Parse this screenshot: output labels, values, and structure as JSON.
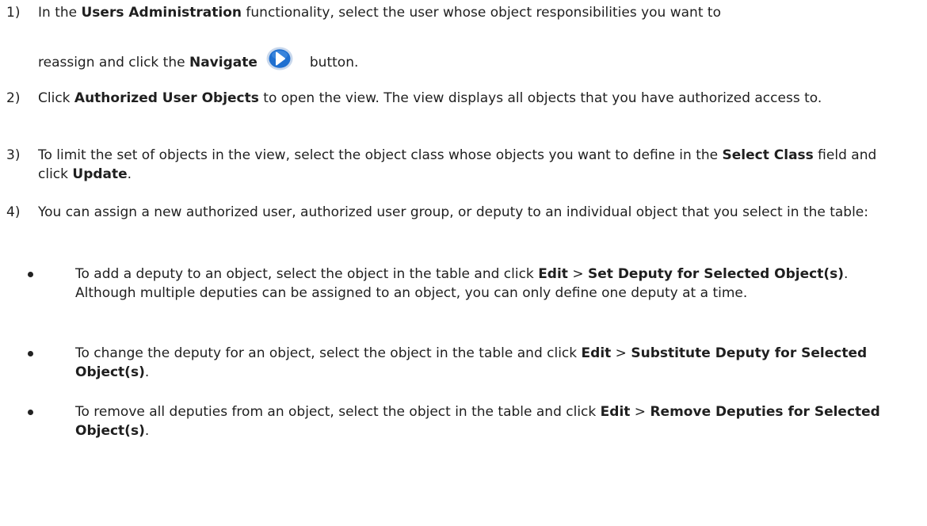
{
  "steps": [
    {
      "num": "1)",
      "t1": "In the ",
      "b1": "Users Administration",
      "t2": " functionality, select the user whose object responsibilities you want to",
      "t3": "reassign and click the ",
      "b2": "Navigate",
      "t4": "button.",
      "icon": "navigate-arrow-icon"
    },
    {
      "num": "2)",
      "t1": "Click ",
      "b1": "Authorized User Objects",
      "t2": " to open the view. The view displays all objects that you have authorized access to."
    },
    {
      "num": "3)",
      "t1": "To limit the set of objects in the view, select the object class whose objects you want to define in the ",
      "b1": "Select Class",
      "t2": " field and click ",
      "b2": "Update",
      "t3": "."
    },
    {
      "num": "4)",
      "t1": "You can assign a new authorized user, authorized user group, or deputy to an individual object that you select in the table:"
    }
  ],
  "bullets": [
    {
      "t1": "To add a deputy to an object, select the object in the table and click ",
      "b1": "Edit",
      "t2": " > ",
      "b2": "Set Deputy for Selected Object(s)",
      "t3": ". Although multiple deputies can be assigned to an object, you can only define one deputy at a time."
    },
    {
      "t1": "To change the deputy for an object, select the object in the table and click ",
      "b1": "Edit",
      "t2": " > ",
      "b2": "Substitute Deputy for Selected Object(s)",
      "t3": "."
    },
    {
      "t1": "To remove all deputies from an object, select the object in the table and click ",
      "b1": "Edit",
      "t2": " > ",
      "b2": "Remove Deputies for Selected Object(s)",
      "t3": "."
    }
  ],
  "colors": {
    "icon_blue": "#1e6fd0",
    "icon_ring": "#c9d8ec",
    "text": "#1f1f1f"
  }
}
